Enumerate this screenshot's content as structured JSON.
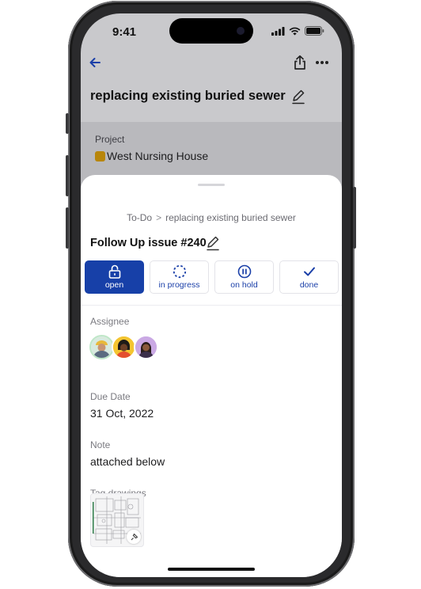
{
  "status_bar": {
    "time": "9:41"
  },
  "header": {
    "title": "replacing existing buried sewer",
    "back_icon": "arrow-left-icon",
    "share_icon": "share-icon",
    "more_icon": "ellipsis-icon"
  },
  "project": {
    "label": "Project",
    "name": "West Nursing House",
    "swatch_color": "#b8860b"
  },
  "sheet": {
    "breadcrumb": {
      "parent": "To-Do",
      "separator": ">",
      "current": "replacing existing buried sewer"
    },
    "issue_title": "Follow Up issue #240",
    "statuses": [
      {
        "label": "open",
        "icon": "unlock-icon",
        "active": true
      },
      {
        "label": "in progress",
        "icon": "progress-circle-icon",
        "active": false
      },
      {
        "label": "on hold",
        "icon": "pause-circle-icon",
        "active": false
      },
      {
        "label": "done",
        "icon": "check-icon",
        "active": false
      }
    ],
    "assignee": {
      "label": "Assignee",
      "count": 3
    },
    "due_date": {
      "label": "Due Date",
      "value": "31 Oct, 2022"
    },
    "note": {
      "label": "Note",
      "value": "attached below"
    },
    "tag_drawings": {
      "label": "Tag drawings"
    }
  },
  "colors": {
    "accent": "#1740a8",
    "dim_background": "#c9c9cc"
  }
}
